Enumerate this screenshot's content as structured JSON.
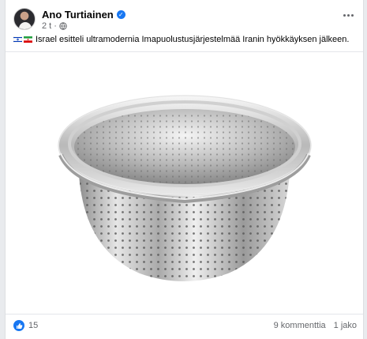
{
  "post": {
    "author": "Ano Turtiainen",
    "time": "2 t",
    "text": "Israel esitteli ultramodernia Imapuolustusjärjestelmää Iranin hyökkäyksen jälkeen.",
    "flags": [
      "israel-flag-icon",
      "iran-flag-icon"
    ]
  },
  "footer": {
    "reaction_count": "15",
    "comments": "9 kommenttia",
    "shares": "1 jako"
  },
  "icons": {
    "verified": "verified-badge-icon",
    "audience": "globe-icon",
    "more": "more-options-icon",
    "reaction": "like-icon",
    "image": "colander-image"
  },
  "colors": {
    "facebook_blue": "#1877f2",
    "secondary_text": "#65676b"
  }
}
